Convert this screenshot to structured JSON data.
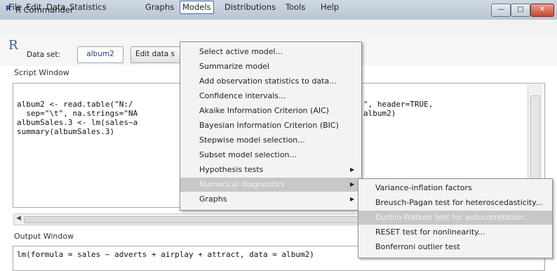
{
  "window": {
    "title": "R Commander",
    "icon": "R-icon"
  },
  "menubar": [
    "File",
    "Edit",
    "Data",
    "Statistics",
    "Graphs",
    "Models",
    "Distributions",
    "Tools",
    "Help"
  ],
  "toolbar": {
    "dataset_label": "Data set:",
    "dataset_value": "album2",
    "edit_label": "Edit data s"
  },
  "script": {
    "label": "Script Window",
    "lines": [
      "album2 <- read.table(\"N:/",
      "  sep=\"\\t\", na.strings=\"NA",
      "albumSales.3 <- lm(sales~a",
      "summary(albumSales.3)"
    ],
    "lines_right": [
      "\", header=TRUE,",
      "",
      "album2)",
      ""
    ]
  },
  "output": {
    "label": "Output Window",
    "line": "lm(formula = sales ~ adverts + airplay + attract, data = album2)"
  },
  "models_menu": {
    "items": [
      {
        "label": "Select active model...",
        "submenu": false
      },
      {
        "label": "Summarize model",
        "submenu": false
      },
      {
        "label": "Add observation statistics to data...",
        "submenu": false
      },
      {
        "label": "Confidence intervals...",
        "submenu": false
      },
      {
        "label": "Akaike Information Criterion (AIC)",
        "submenu": false
      },
      {
        "label": "Bayesian Information Criterion (BIC)",
        "submenu": false
      },
      {
        "label": "Stepwise model selection...",
        "submenu": false
      },
      {
        "label": "Subset model selection...",
        "submenu": false
      },
      {
        "label": "Hypothesis tests",
        "submenu": true
      },
      {
        "label": "Numerical diagnostics",
        "submenu": true,
        "selected": true
      },
      {
        "label": "Graphs",
        "submenu": true
      }
    ]
  },
  "diagnostics_submenu": {
    "items": [
      {
        "label": "Variance-inflation factors"
      },
      {
        "label": "Breusch-Pagan test for heteroscedasticity..."
      },
      {
        "label": "Durbin-Watson test for autocorrelation...",
        "selected": true
      },
      {
        "label": "RESET test for nonlinearity..."
      },
      {
        "label": "Bonferroni outlier test"
      }
    ]
  }
}
